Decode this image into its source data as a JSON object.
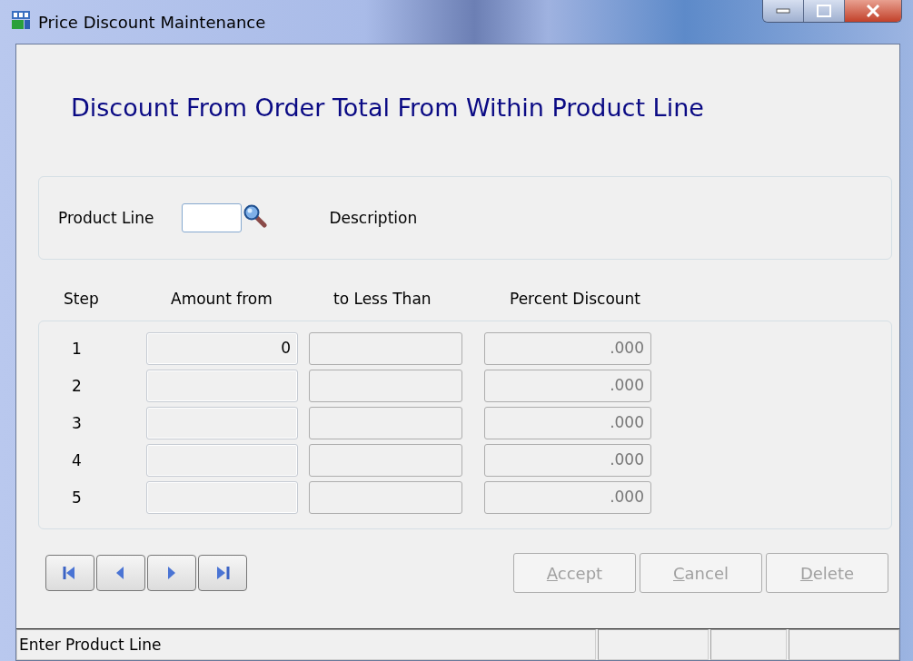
{
  "window": {
    "title": "Price Discount Maintenance"
  },
  "heading": "Discount From Order Total From Within Product Line",
  "product": {
    "label": "Product Line",
    "description_label": "Description"
  },
  "grid": {
    "columns": [
      "Step",
      "Amount from",
      "to Less Than",
      "Percent Discount"
    ],
    "rows": [
      {
        "step": "1",
        "amount_from": "0",
        "percent": ".000"
      },
      {
        "step": "2",
        "percent": ".000"
      },
      {
        "step": "3",
        "percent": ".000"
      },
      {
        "step": "4",
        "percent": ".000"
      },
      {
        "step": "5",
        "percent": ".000"
      }
    ]
  },
  "nav_buttons": [
    {
      "kind": "first"
    },
    {
      "kind": "prev"
    },
    {
      "kind": "next"
    },
    {
      "kind": "last"
    }
  ],
  "buttons": [
    {
      "label": "Accept",
      "disabled": true
    },
    {
      "label": "Cancel",
      "disabled": true
    },
    {
      "label": "Delete",
      "disabled": true
    }
  ],
  "status_bar": {
    "message": "Enter Product Line"
  }
}
